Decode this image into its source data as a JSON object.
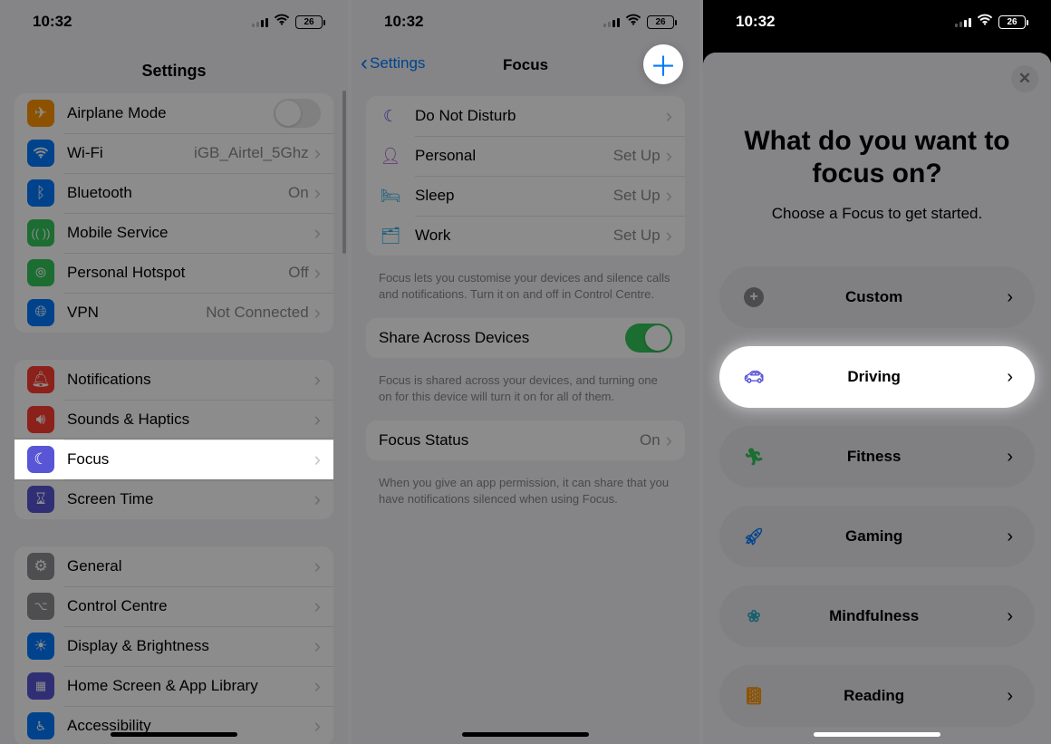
{
  "status": {
    "time": "10:32",
    "battery": "26"
  },
  "screen1": {
    "title": "Settings",
    "group1": {
      "airplane": "Airplane Mode",
      "wifi": "Wi-Fi",
      "wifi_val": "iGB_Airtel_5Ghz",
      "bluetooth": "Bluetooth",
      "bluetooth_val": "On",
      "mobile": "Mobile Service",
      "hotspot": "Personal Hotspot",
      "hotspot_val": "Off",
      "vpn": "VPN",
      "vpn_val": "Not Connected"
    },
    "group2": {
      "notifications": "Notifications",
      "sounds": "Sounds & Haptics",
      "focus": "Focus",
      "screentime": "Screen Time"
    },
    "group3": {
      "general": "General",
      "control": "Control Centre",
      "display": "Display & Brightness",
      "home": "Home Screen & App Library",
      "accessibility": "Accessibility"
    }
  },
  "screen2": {
    "back": "Settings",
    "title": "Focus",
    "items": {
      "dnd": "Do Not Disturb",
      "personal": "Personal",
      "personal_val": "Set Up",
      "sleep": "Sleep",
      "sleep_val": "Set Up",
      "work": "Work",
      "work_val": "Set Up"
    },
    "footer1": "Focus lets you customise your devices and silence calls and notifications. Turn it on and off in Control Centre.",
    "share": "Share Across Devices",
    "footer2": "Focus is shared across your devices, and turning one on for this device will turn it on for all of them.",
    "status": "Focus Status",
    "status_val": "On",
    "footer3": "When you give an app permission, it can share that you have notifications silenced when using Focus."
  },
  "screen3": {
    "heading": "What do you want to focus on?",
    "sub": "Choose a Focus to get started.",
    "options": {
      "custom": "Custom",
      "driving": "Driving",
      "fitness": "Fitness",
      "gaming": "Gaming",
      "mindfulness": "Mindfulness",
      "reading": "Reading"
    }
  }
}
